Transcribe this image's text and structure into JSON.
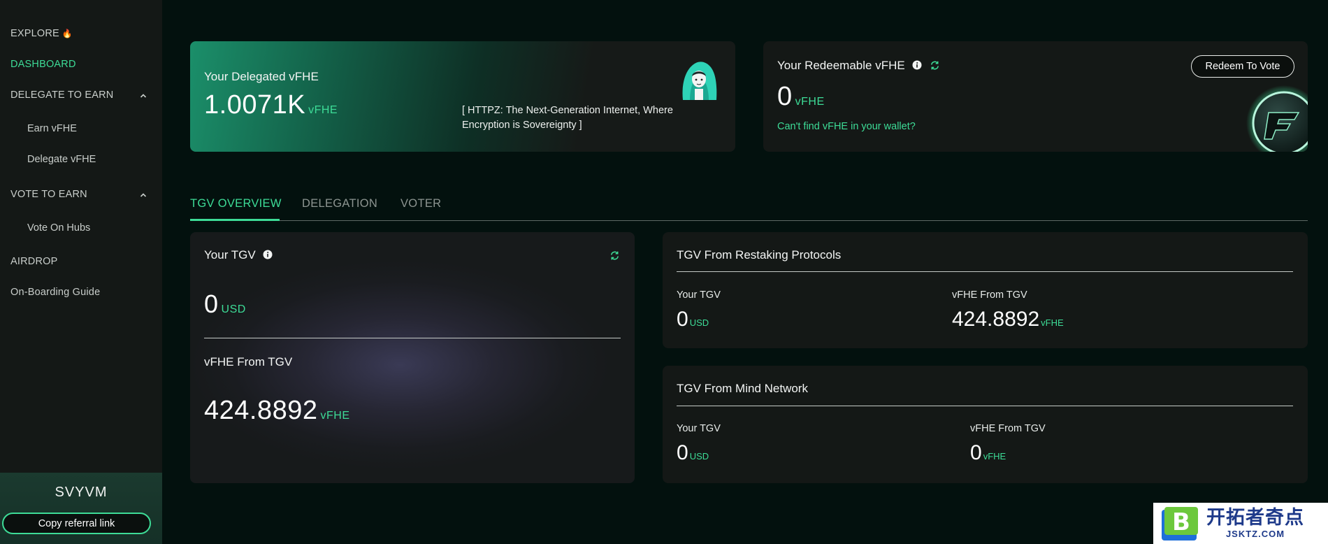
{
  "sidebar": {
    "items": [
      {
        "label": "EXPLORE"
      },
      {
        "label": "DASHBOARD"
      },
      {
        "label": "DELEGATE TO EARN"
      },
      {
        "label": "Earn vFHE"
      },
      {
        "label": "Delegate vFHE"
      },
      {
        "label": "VOTE TO EARN"
      },
      {
        "label": "Vote On Hubs"
      },
      {
        "label": "AIRDROP"
      },
      {
        "label": "On-Boarding Guide"
      }
    ],
    "explore_emoji": "🔥",
    "username": "SVYVM",
    "referral_button": "Copy referral link"
  },
  "delegated": {
    "title": "Your Delegated vFHE",
    "value": "1.0071K",
    "unit": "vFHE",
    "quote": "[ HTTPZ: The Next-Generation Internet, Where Encryption is Sovereignty ]"
  },
  "redeemable": {
    "title": "Your Redeemable vFHE",
    "value": "0",
    "unit": "vFHE",
    "link": "Can't find vFHE in your wallet?",
    "button": "Redeem To Vote"
  },
  "tabs": [
    {
      "label": "TGV OVERVIEW",
      "active": true
    },
    {
      "label": "DELEGATION",
      "active": false
    },
    {
      "label": "VOTER",
      "active": false
    }
  ],
  "tgv": {
    "title": "Your TGV",
    "value": "0",
    "unit": "USD",
    "vfhe_label": "vFHE From TGV",
    "vfhe_value": "424.8892",
    "vfhe_unit": "vFHE"
  },
  "restaking": {
    "title": "TGV From Restaking Protocols",
    "tgv_label": "Your TGV",
    "tgv_value": "0",
    "tgv_unit": "USD",
    "vfhe_label": "vFHE From TGV",
    "vfhe_value": "424.8892",
    "vfhe_unit": "vFHE"
  },
  "mind": {
    "title": "TGV From Mind Network",
    "tgv_label": "Your TGV",
    "tgv_value": "0",
    "tgv_unit": "USD",
    "vfhe_label": "vFHE From TGV",
    "vfhe_value": "0",
    "vfhe_unit": "vFHE"
  },
  "watermark": {
    "letter": "B",
    "cn": "开拓者奇点",
    "en": "JSKTZ.COM"
  },
  "colors": {
    "accent": "#3ddc97",
    "background": "#03110e",
    "card": "#141816"
  }
}
